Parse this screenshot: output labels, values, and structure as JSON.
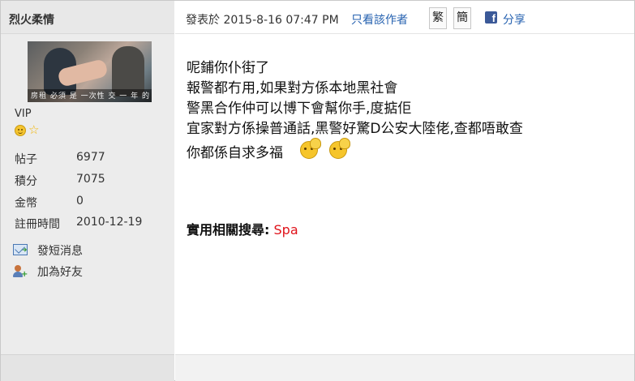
{
  "user": {
    "name": "烈火柔情",
    "avatar_caption": "房租 必須 是 一次性 交 一 年 的",
    "group": "VIP",
    "stats": [
      {
        "label": "帖子",
        "value": "6977"
      },
      {
        "label": "積分",
        "value": "7075"
      },
      {
        "label": "金幣",
        "value": "0"
      },
      {
        "label": "註冊時間",
        "value": "2010-12-19"
      }
    ],
    "actions": [
      {
        "label": "發短消息",
        "icon": "mail-icon"
      },
      {
        "label": "加為好友",
        "icon": "add-friend-icon"
      }
    ]
  },
  "post": {
    "meta": "發表於 2015-8-16 07:47 PM",
    "author_only": "只看該作者",
    "traditional": "繁",
    "simplified": "簡",
    "share": "分享",
    "lines": [
      "呢鋪你仆街了",
      "報警都冇用,如果對方係本地黑社會",
      "警黑合作仲可以博下會幫你手,度掂佢",
      "宜家對方係操普通話,黑警好驚D公安大陸佬,查都唔敢查",
      "你都係自求多福"
    ],
    "related_label": "實用相關搜尋:",
    "related_link": "Spa"
  },
  "colors": {
    "link": "#2662b0",
    "related_link": "#e0121a",
    "sidebar_bg": "#e8e8e8"
  }
}
